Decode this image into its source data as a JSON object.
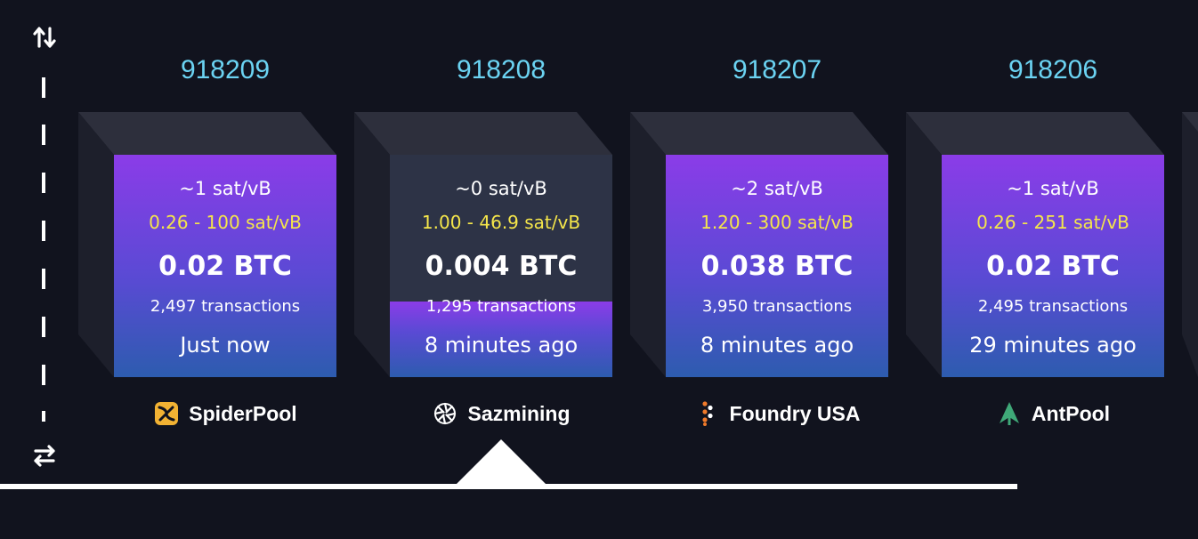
{
  "blocks": [
    {
      "height": "918209",
      "median_fee": "~1 sat/vB",
      "fee_range": "0.26 - 100 sat/vB",
      "reward": "0.02 BTC",
      "transactions": "2,497 transactions",
      "time_ago": "Just now",
      "pool": "SpiderPool",
      "fullness": 1.0
    },
    {
      "height": "918208",
      "median_fee": "~0 sat/vB",
      "fee_range": "1.00 - 46.9 sat/vB",
      "reward": "0.004 BTC",
      "transactions": "1,295 transactions",
      "time_ago": "8 minutes ago",
      "pool": "Sazmining",
      "fullness": 0.34
    },
    {
      "height": "918207",
      "median_fee": "~2 sat/vB",
      "fee_range": "1.20 - 300 sat/vB",
      "reward": "0.038 BTC",
      "transactions": "3,950 transactions",
      "time_ago": "8 minutes ago",
      "pool": "Foundry USA",
      "fullness": 1.0
    },
    {
      "height": "918206",
      "median_fee": "~1 sat/vB",
      "fee_range": "0.26 - 251 sat/vB",
      "reward": "0.02 BTC",
      "transactions": "2,495 transactions",
      "time_ago": "29 minutes ago",
      "pool": "AntPool",
      "fullness": 1.0
    }
  ],
  "icons": {
    "top_rail": "swap-vertical-icon",
    "bottom_rail": "swap-horizontal-icon",
    "pools": [
      "spiderpool-logo",
      "sazmining-logo",
      "foundry-usa-logo",
      "antpool-logo"
    ]
  },
  "colors": {
    "background": "#11131e",
    "block_height": "#6bd3f2",
    "fee_range": "#f5e64a",
    "block_fill_top": "#8b3ce8",
    "block_fill_bottom": "#2d5caf",
    "block_empty": "#2d3346"
  }
}
